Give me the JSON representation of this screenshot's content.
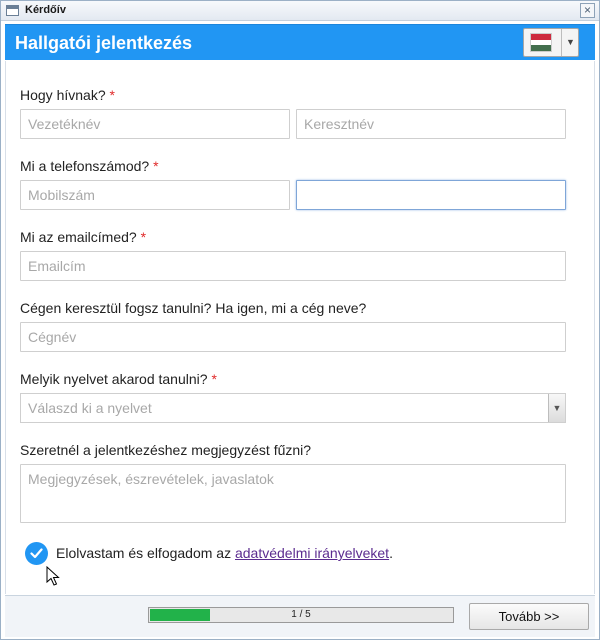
{
  "window": {
    "title": "Kérdőív",
    "close_glyph": "×"
  },
  "header": {
    "title": "Hallgatói jelentkezés",
    "language_flag": "hungary-flag-icon",
    "accent_color": "#2196f3"
  },
  "form": {
    "name": {
      "label": "Hogy hívnak?",
      "required_mark": "*",
      "last_name_placeholder": "Vezetéknév",
      "first_name_placeholder": "Keresztnév"
    },
    "phone": {
      "label": "Mi a telefonszámod?",
      "required_mark": "*",
      "mobile_placeholder": "Mobilszám",
      "second_value": ""
    },
    "email": {
      "label": "Mi az emailcímed?",
      "required_mark": "*",
      "placeholder": "Emailcím"
    },
    "company": {
      "label": "Cégen keresztül fogsz tanulni? Ha igen, mi a cég neve?",
      "placeholder": "Cégnév"
    },
    "language": {
      "label": "Melyik nyelvet akarod tanulni?",
      "required_mark": "*",
      "selected": "Válaszd ki a nyelvet"
    },
    "comment": {
      "label": "Szeretnél a jelentkezéshez megjegyzést fűzni?",
      "placeholder": "Megjegyzések, észrevételek, javaslatok"
    },
    "consent": {
      "checked": true,
      "text_before": "Elolvastam és elfogadom az ",
      "link_text": "adatvédelmi irányelveket",
      "text_after": "."
    }
  },
  "footer": {
    "progress_text": "1 / 5",
    "progress_fraction": 0.2,
    "progress_color": "#22b24a",
    "next_label": "Tovább >>"
  }
}
